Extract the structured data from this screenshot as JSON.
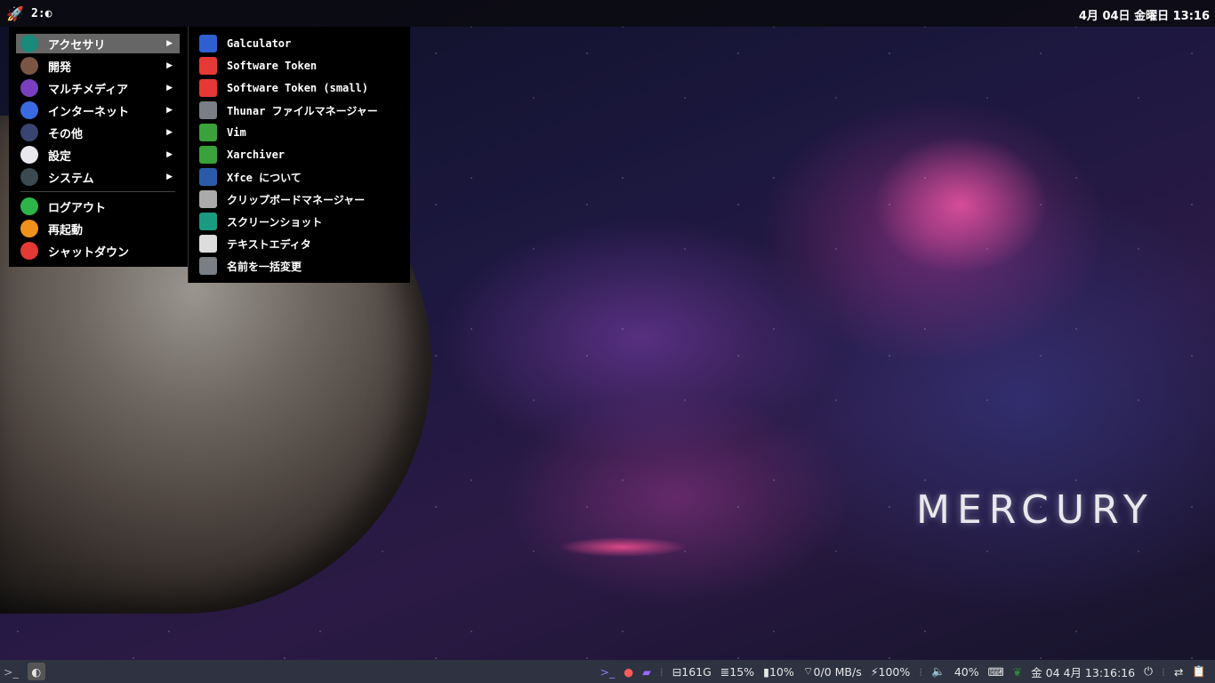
{
  "topbar": {
    "workspace": "2:",
    "clock": "4月 04日 金曜日 13:16"
  },
  "menu": {
    "categories": [
      {
        "label": "アクセサリ",
        "icon": "accessories-icon",
        "color": "#1a8a7a",
        "selected": true
      },
      {
        "label": "開発",
        "icon": "hammer-icon",
        "color": "#7a5545"
      },
      {
        "label": "マルチメディア",
        "icon": "multimedia-icon",
        "color": "#7a3fc0"
      },
      {
        "label": "インターネット",
        "icon": "globe-icon",
        "color": "#3a6ae0"
      },
      {
        "label": "その他",
        "icon": "more-icon",
        "color": "#3a4470"
      },
      {
        "label": "設定",
        "icon": "settings-icon",
        "color": "#e8e8ee"
      },
      {
        "label": "システム",
        "icon": "gear-icon",
        "color": "#3a4a50"
      }
    ],
    "actions": [
      {
        "label": "ログアウト",
        "icon": "logout-icon",
        "color": "#2fb44a"
      },
      {
        "label": "再起動",
        "icon": "restart-icon",
        "color": "#f0921a"
      },
      {
        "label": "シャットダウン",
        "icon": "power-icon",
        "color": "#e53935"
      }
    ]
  },
  "submenu": {
    "items": [
      {
        "label": "Galculator",
        "icon": "calculator-icon",
        "color": "#2f5fd0"
      },
      {
        "label": "Software Token",
        "icon": "token-icon",
        "color": "#e53935"
      },
      {
        "label": "Software Token (small)",
        "icon": "token-icon",
        "color": "#e53935"
      },
      {
        "label": "Thunar ファイルマネージャー",
        "icon": "file-manager-icon",
        "color": "#7a7f85"
      },
      {
        "label": "Vim",
        "icon": "vim-icon",
        "color": "#3aa23a"
      },
      {
        "label": "Xarchiver",
        "icon": "archive-icon",
        "color": "#3aa23a"
      },
      {
        "label": "Xfce について",
        "icon": "xfce-icon",
        "color": "#2a5aa8"
      },
      {
        "label": "クリップボードマネージャー",
        "icon": "clipboard-icon",
        "color": "#aaaaaa"
      },
      {
        "label": "スクリーンショット",
        "icon": "screenshot-icon",
        "color": "#1a9a80"
      },
      {
        "label": "テキストエディタ",
        "icon": "text-editor-icon",
        "color": "#dddddd"
      },
      {
        "label": "名前を一括変更",
        "icon": "rename-icon",
        "color": "#7a7f85"
      }
    ]
  },
  "desktop": {
    "wallpaper_text": "MERCURY"
  },
  "bottombar": {
    "terminal": ">_",
    "disk": "161G",
    "memory": "15%",
    "cpu": "10%",
    "network": "0/0 MB/s",
    "battery": "100%",
    "volume": "40%",
    "date": "金 04  4月 13:16:16"
  }
}
